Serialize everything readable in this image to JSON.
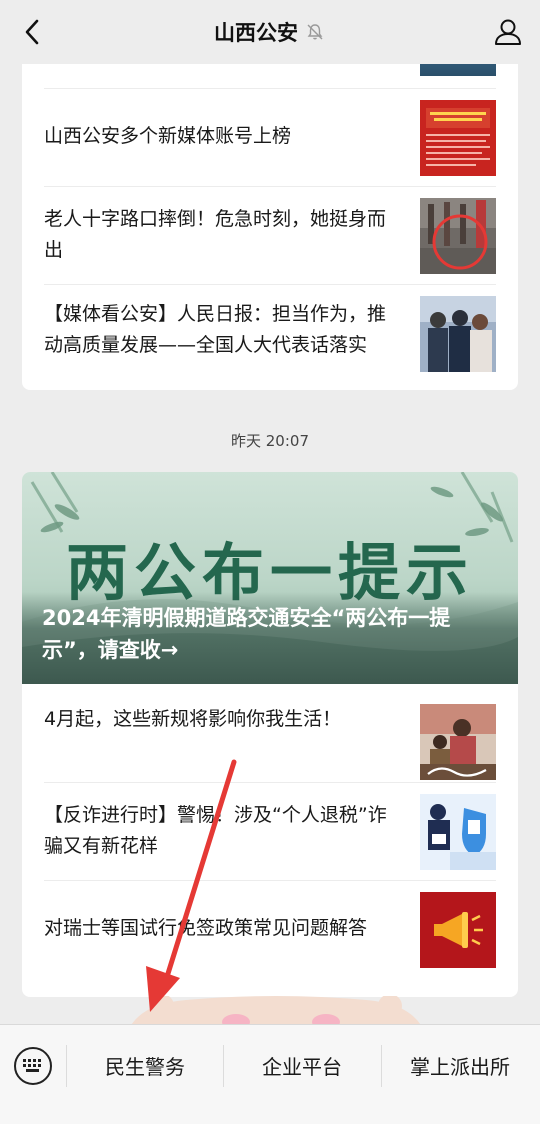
{
  "header": {
    "title": "山西公安",
    "back_icon": "chevron-left-icon",
    "mute_icon": "bell-muted-icon",
    "profile_icon": "person-icon"
  },
  "message_group_1": {
    "articles": [
      {
        "title": "山西公安多个新媒体账号上榜",
        "thumb": "red-notice-thumbnail"
      },
      {
        "title": "老人十字路口摔倒！危急时刻，她挺身而出",
        "thumb": "street-scene-thumbnail"
      },
      {
        "title": "【媒体看公安】人民日报：担当作为，推动高质量发展——全国人大代表话落实",
        "thumb": "police-group-thumbnail"
      }
    ]
  },
  "timestamp": "昨天 20:07",
  "message_group_2": {
    "banner": {
      "big_text": "两公布一提示",
      "caption": "2024年清明假期道路交通安全“两公布一提示”，请查收→"
    },
    "articles": [
      {
        "title": "4月起，这些新规将影响你我生活！",
        "thumb": "new-rules-thumbnail"
      },
      {
        "title": "【反诈进行时】警惕！涉及“个人退税”诈骗又有新花样",
        "thumb": "anti-fraud-thumbnail"
      },
      {
        "title": "对瑞士等国试行免签政策常见问题解答",
        "thumb": "megaphone-thumbnail"
      }
    ]
  },
  "bottom_menu": {
    "keyboard_icon": "keyboard-icon",
    "items": [
      "民生警务",
      "企业平台",
      "掌上派出所"
    ]
  },
  "colors": {
    "background": "#ededed",
    "card": "#ffffff",
    "annotation_arrow": "#e53935"
  }
}
